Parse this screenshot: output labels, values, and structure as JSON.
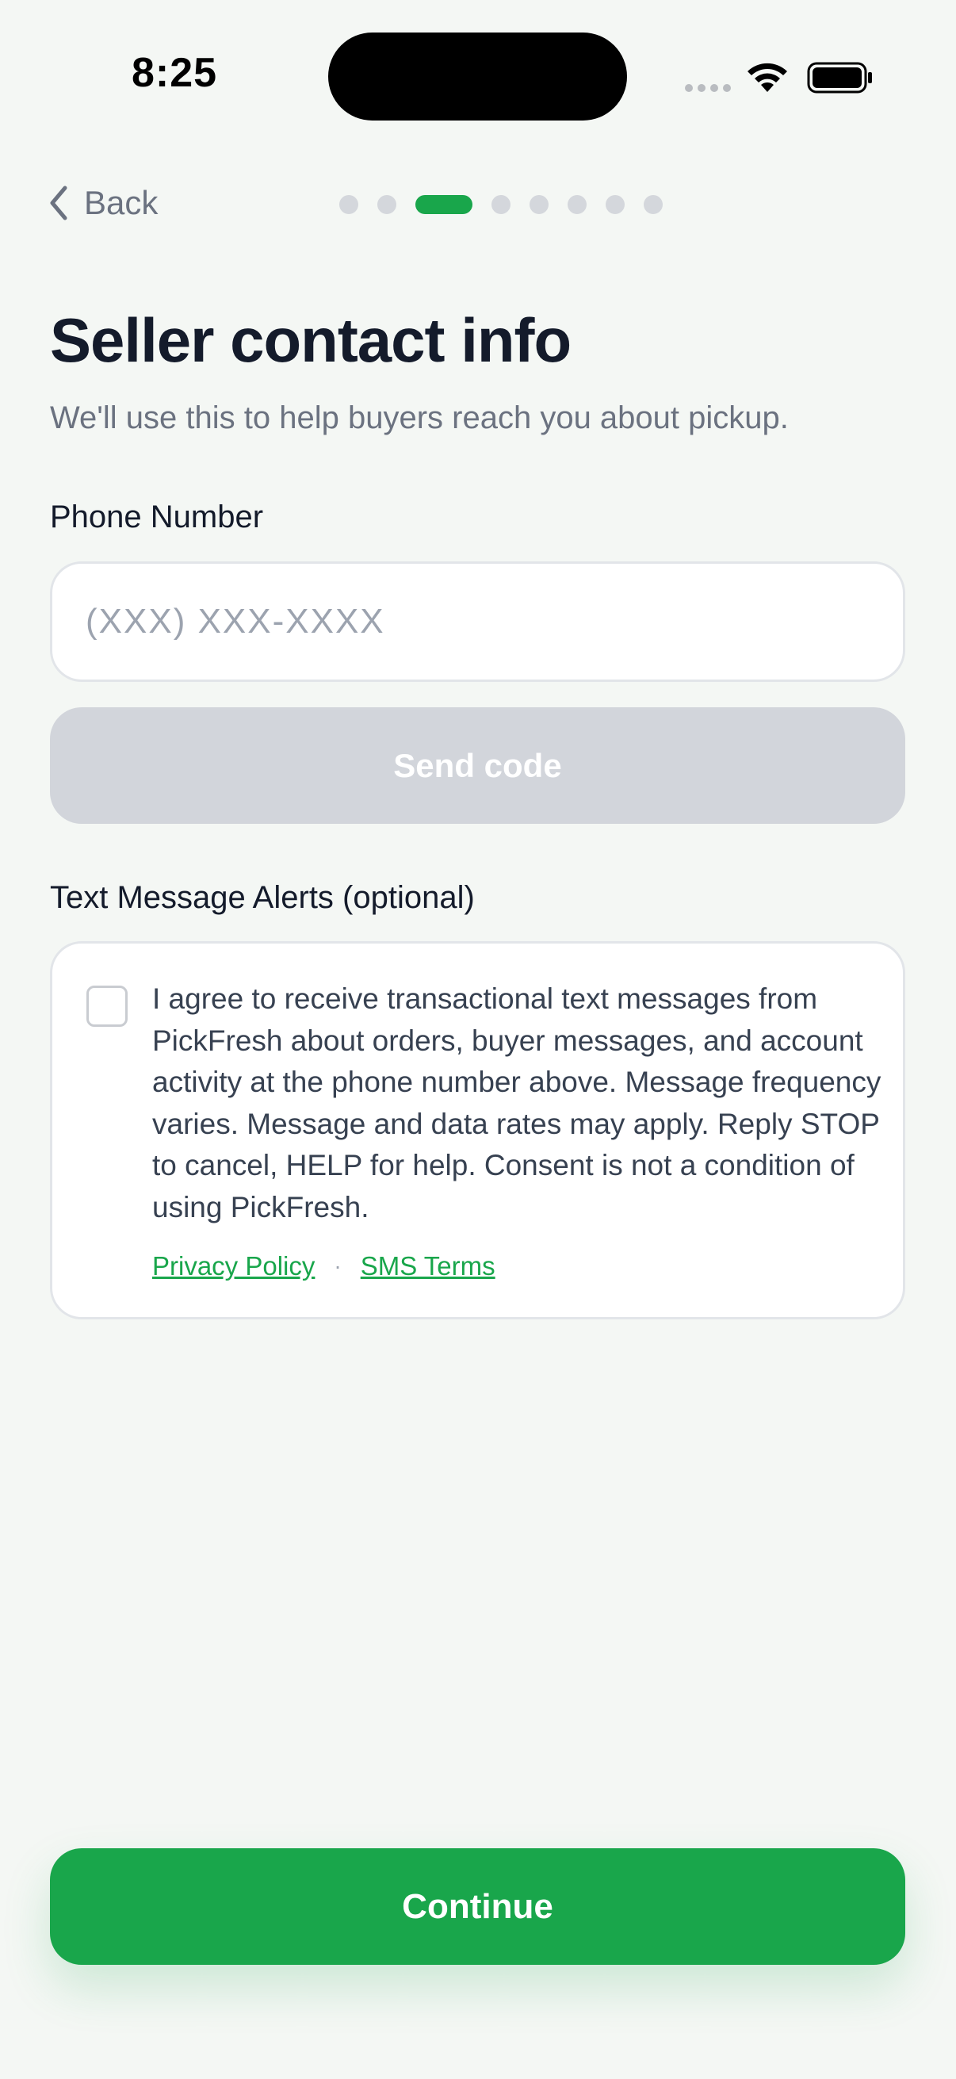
{
  "status_bar": {
    "time": "8:25",
    "icons": [
      "signal-icon",
      "wifi-icon",
      "battery-icon"
    ]
  },
  "nav": {
    "back_label": "Back",
    "back_icon": "chevron-left-icon",
    "progress": {
      "total_steps": 8,
      "current_step": 3
    }
  },
  "header": {
    "title": "Seller contact info",
    "subtitle": "We'll use this to help buyers reach you about pickup."
  },
  "phone": {
    "label": "Phone Number",
    "placeholder": "(XXX) XXX-XXXX",
    "value": "",
    "send_code_label": "Send code"
  },
  "sms": {
    "label": "Text Message Alerts (optional)",
    "checked": false,
    "consent_text": "I agree to receive transactional text messages from PickFresh about orders, buyer messages, and account activity at the phone number above. Message frequency varies. Message and data rates may apply. Reply STOP to cancel, HELP for help. Consent is not a condition of using PickFresh.",
    "privacy_link": "Privacy Policy",
    "separator": "·",
    "terms_link": "SMS Terms"
  },
  "footer": {
    "continue_label": "Continue"
  },
  "colors": {
    "accent": "#19a64b",
    "background": "#f4f7f4",
    "disabled_button": "#d2d5db",
    "text_primary": "#141b2b",
    "text_secondary": "#6b7280"
  }
}
